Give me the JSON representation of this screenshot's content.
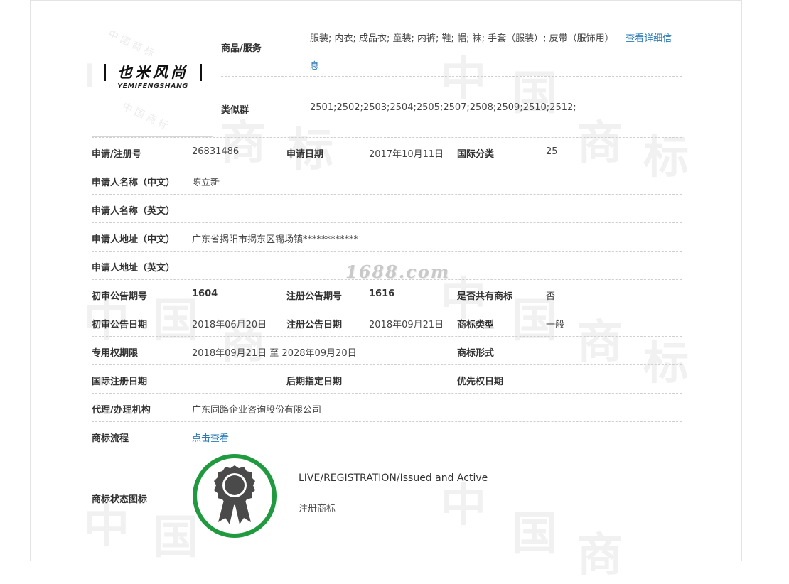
{
  "logo": {
    "brand_cn": "也米风尚",
    "brand_en": "YEMIFENGSHANG"
  },
  "goods": {
    "label": "商品/服务",
    "value": "服装; 内衣; 成品衣; 童装; 内裤; 鞋; 帽; 袜; 手套（服装）; 皮带（服饰用）",
    "link": "查看详细信息"
  },
  "similar_group": {
    "label": "类似群",
    "value": "2501;2502;2503;2504;2505;2507;2508;2509;2510;2512;"
  },
  "rows": {
    "reg_no": {
      "label": "申请/注册号",
      "value": "26831486"
    },
    "apply_date": {
      "label": "申请日期",
      "value": "2017年10月11日"
    },
    "intl_class": {
      "label": "国际分类",
      "value": "25"
    },
    "applicant_cn": {
      "label": "申请人名称（中文）",
      "value": "陈立新"
    },
    "applicant_en": {
      "label": "申请人名称（英文）",
      "value": ""
    },
    "address_cn": {
      "label": "申请人地址（中文）",
      "value": "广东省揭阳市揭东区锡场镇************"
    },
    "address_en": {
      "label": "申请人地址（英文）",
      "value": ""
    },
    "prelim_issue": {
      "label": "初审公告期号",
      "value": "1604"
    },
    "reg_issue": {
      "label": "注册公告期号",
      "value": "1616"
    },
    "shared": {
      "label": "是否共有商标",
      "value": "否"
    },
    "prelim_date": {
      "label": "初审公告日期",
      "value": "2018年06月20日"
    },
    "reg_date": {
      "label": "注册公告日期",
      "value": "2018年09月21日"
    },
    "tm_type": {
      "label": "商标类型",
      "value": "一般"
    },
    "exclusive_period": {
      "label": "专用权期限",
      "value": "2018年09月21日 至 2028年09月20日"
    },
    "tm_form": {
      "label": "商标形式",
      "value": ""
    },
    "intl_reg_date": {
      "label": "国际注册日期",
      "value": ""
    },
    "later_designation": {
      "label": "后期指定日期",
      "value": ""
    },
    "priority_date": {
      "label": "优先权日期",
      "value": ""
    },
    "agency": {
      "label": "代理/办理机构",
      "value": "广东同路企业咨询股份有限公司"
    },
    "process": {
      "label": "商标流程",
      "link": "点击查看"
    },
    "status_icon": {
      "label": "商标状态图标"
    }
  },
  "status": {
    "en": "LIVE/REGISTRATION/Issued and Active",
    "cn": "注册商标"
  },
  "watermark": {
    "site": "1688.com",
    "chars": [
      "中",
      "国",
      "商",
      "标"
    ]
  },
  "colors": {
    "accent_link": "#2a7ab6",
    "badge_green": "#1f9a3e",
    "badge_dark": "#4a4a4a"
  }
}
